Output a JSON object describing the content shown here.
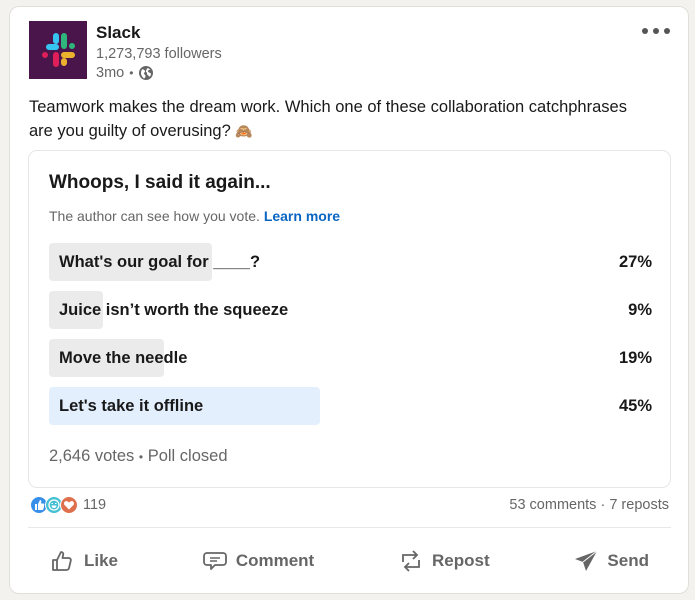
{
  "author": {
    "name": "Slack",
    "followers": "1,273,793 followers",
    "age": "3mo",
    "separator": "•",
    "visibility_icon": "globe-icon",
    "logo_colors": {
      "background": "#4a154b",
      "blue": "#36c5f0",
      "green": "#2eb67d",
      "yellow": "#ecb22e",
      "red": "#e01e5a"
    }
  },
  "menu": {
    "icon": "more-horizontal-icon"
  },
  "post": {
    "text_line1": "Teamwork makes the dream work. Which one of these collaboration catchphrases",
    "text_line2": "are you guilty of overusing?",
    "emoji": "🙈"
  },
  "poll": {
    "title": "Whoops, I said it again...",
    "note": "The author can see how you vote.",
    "learn_more": "Learn more",
    "options": [
      {
        "label": "What's our goal for ____?",
        "percent": "27%",
        "value": 27,
        "winner": false
      },
      {
        "label": "Juice isn’t worth the squeeze",
        "percent": "9%",
        "value": 9,
        "winner": false
      },
      {
        "label": "Move the needle",
        "percent": "19%",
        "value": 19,
        "winner": false
      },
      {
        "label": "Let's take it offline",
        "percent": "45%",
        "value": 45,
        "winner": true
      }
    ],
    "votes": "2,646 votes",
    "separator": "•",
    "status": "Poll closed",
    "colors": {
      "bar": "#ebebeb",
      "winner_bar": "#e3effc",
      "link": "#0a66c2"
    }
  },
  "social": {
    "reactions": [
      "like-reaction-icon",
      "funny-reaction-icon",
      "love-reaction-icon"
    ],
    "reaction_count": "119",
    "comments": "53 comments",
    "separator": "·",
    "reposts": "7 reposts"
  },
  "actions": [
    {
      "label": "Like",
      "icon": "thumbs-up-icon"
    },
    {
      "label": "Comment",
      "icon": "comment-icon"
    },
    {
      "label": "Repost",
      "icon": "repost-icon"
    },
    {
      "label": "Send",
      "icon": "send-icon"
    }
  ]
}
